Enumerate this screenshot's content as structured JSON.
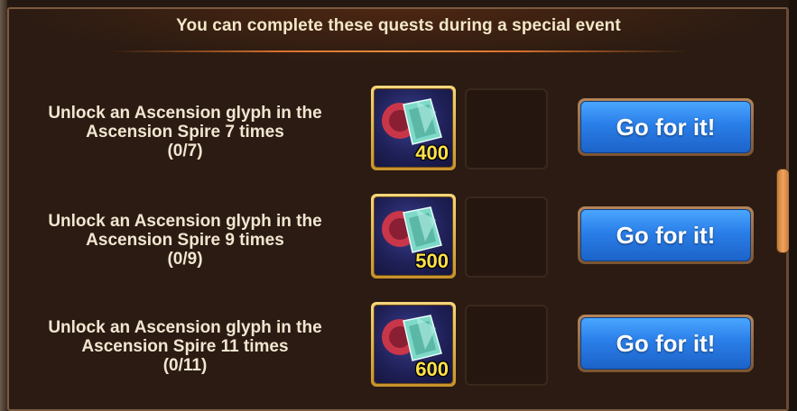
{
  "header": {
    "title": "You can complete these quests during a special event"
  },
  "quests": [
    {
      "line1": "Unlock an Ascension glyph in the",
      "line2": "Ascension Spire 7 times",
      "progress": "(0/7)",
      "reward_amount": "400",
      "reward_icon": "ascension-glyph-icon",
      "button_label": "Go for it!"
    },
    {
      "line1": "Unlock an Ascension glyph in the",
      "line2": "Ascension Spire 9 times",
      "progress": "(0/9)",
      "reward_amount": "500",
      "reward_icon": "ascension-glyph-icon",
      "button_label": "Go for it!"
    },
    {
      "line1": "Unlock an Ascension glyph in the",
      "line2": "Ascension Spire 11 times",
      "progress": "(0/11)",
      "reward_amount": "600",
      "reward_icon": "ascension-glyph-icon",
      "button_label": "Go for it!"
    }
  ],
  "colors": {
    "panel_bg": "#2b1b12",
    "header_text": "#f3e7c8",
    "accent_line": "#e58b3a",
    "button_blue": "#2a7ee8",
    "reward_gold": "#ffe24a",
    "scroll_thumb": "#f0a35c"
  }
}
